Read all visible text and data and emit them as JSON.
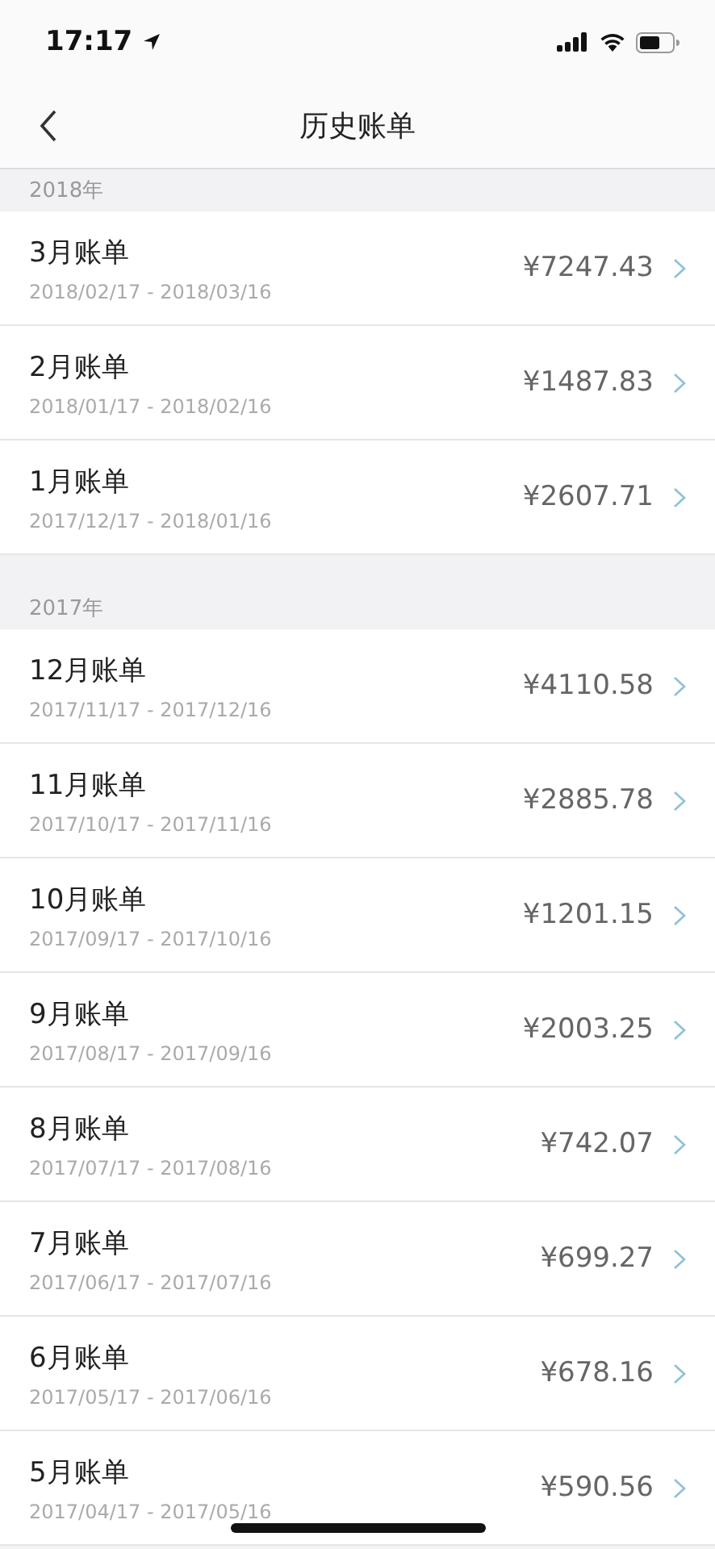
{
  "status_bar": {
    "time": "17:17"
  },
  "nav": {
    "title": "历史账单"
  },
  "sections": [
    {
      "year": "2018年",
      "bills": [
        {
          "title": "3月账单",
          "period": "2018/02/17 - 2018/03/16",
          "amount": "¥7247.43"
        },
        {
          "title": "2月账单",
          "period": "2018/01/17 - 2018/02/16",
          "amount": "¥1487.83"
        },
        {
          "title": "1月账单",
          "period": "2017/12/17 - 2018/01/16",
          "amount": "¥2607.71"
        }
      ]
    },
    {
      "year": "2017年",
      "bills": [
        {
          "title": "12月账单",
          "period": "2017/11/17 - 2017/12/16",
          "amount": "¥4110.58"
        },
        {
          "title": "11月账单",
          "period": "2017/10/17 - 2017/11/16",
          "amount": "¥2885.78"
        },
        {
          "title": "10月账单",
          "period": "2017/09/17 - 2017/10/16",
          "amount": "¥1201.15"
        },
        {
          "title": "9月账单",
          "period": "2017/08/17 - 2017/09/16",
          "amount": "¥2003.25"
        },
        {
          "title": "8月账单",
          "period": "2017/07/17 - 2017/08/16",
          "amount": "¥742.07"
        },
        {
          "title": "7月账单",
          "period": "2017/06/17 - 2017/07/16",
          "amount": "¥699.27"
        },
        {
          "title": "6月账单",
          "period": "2017/05/17 - 2017/06/16",
          "amount": "¥678.16"
        },
        {
          "title": "5月账单",
          "period": "2017/04/17 - 2017/05/16",
          "amount": "¥590.56"
        }
      ]
    }
  ]
}
